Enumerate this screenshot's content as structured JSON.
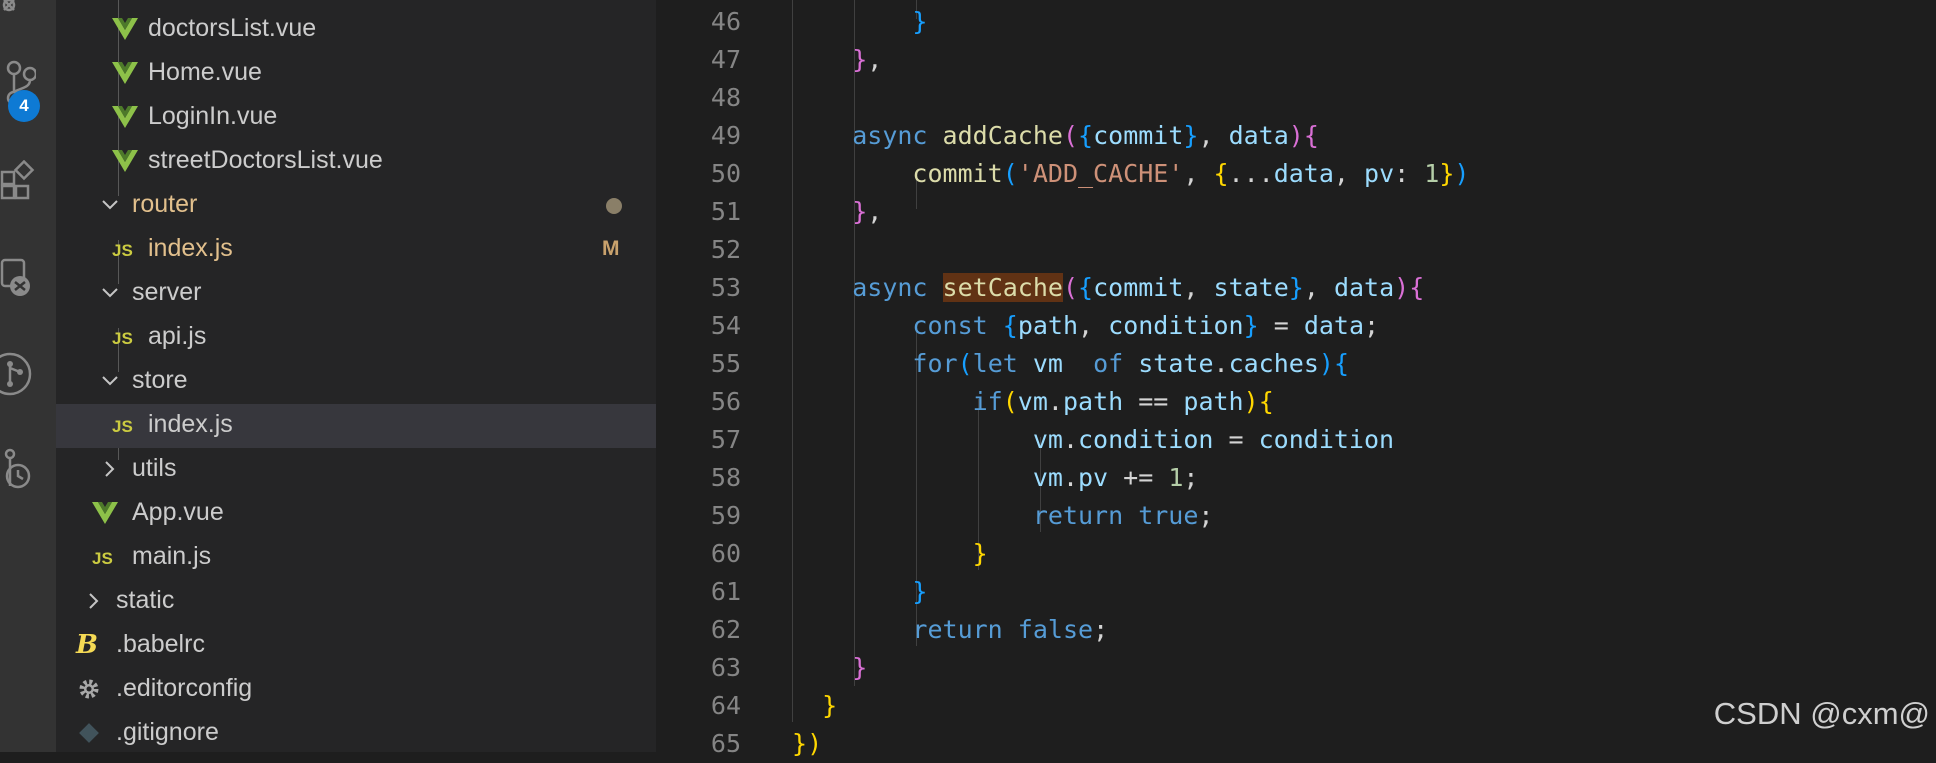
{
  "activity_bar": {
    "scm_badge": "4"
  },
  "explorer": {
    "items": [
      {
        "label": "doctorsList.vue",
        "icon": "vue-icon",
        "indent": 2
      },
      {
        "label": "Home.vue",
        "icon": "vue-icon",
        "indent": 2
      },
      {
        "label": "LoginIn.vue",
        "icon": "vue-icon",
        "indent": 2
      },
      {
        "label": "streetDoctorsList.vue",
        "icon": "vue-icon",
        "indent": 2
      },
      {
        "label": "router",
        "icon": "chevron-down-icon",
        "indent": 1,
        "modified": true,
        "status": "dot"
      },
      {
        "label": "index.js",
        "icon": "js-icon",
        "indent": 2,
        "modified": true,
        "status": "M"
      },
      {
        "label": "server",
        "icon": "chevron-down-icon",
        "indent": 1
      },
      {
        "label": "api.js",
        "icon": "js-icon",
        "indent": 2
      },
      {
        "label": "store",
        "icon": "chevron-down-icon",
        "indent": 1
      },
      {
        "label": "index.js",
        "icon": "js-icon",
        "indent": 2,
        "selected": true
      },
      {
        "label": "utils",
        "icon": "chevron-right-icon",
        "indent": 1
      },
      {
        "label": "App.vue",
        "icon": "vue-icon",
        "indent": 1
      },
      {
        "label": "main.js",
        "icon": "js-icon",
        "indent": 1
      },
      {
        "label": "static",
        "icon": "chevron-right-icon",
        "indent": 0
      },
      {
        "label": ".babelrc",
        "icon": "babel-icon",
        "indent": 0
      },
      {
        "label": ".editorconfig",
        "icon": "gear-icon",
        "indent": 0
      },
      {
        "label": ".gitignore",
        "icon": "git-icon",
        "indent": 0
      }
    ]
  },
  "editor": {
    "lines": [
      {
        "n": "46",
        "text": "        }"
      },
      {
        "n": "47",
        "text": "    },"
      },
      {
        "n": "48",
        "text": ""
      },
      {
        "n": "49",
        "text": "    async addCache({commit}, data){"
      },
      {
        "n": "50",
        "text": "        commit('ADD_CACHE', {...data, pv: 1})"
      },
      {
        "n": "51",
        "text": "    },"
      },
      {
        "n": "52",
        "text": ""
      },
      {
        "n": "53",
        "text": "    async setCache({commit, state}, data){"
      },
      {
        "n": "54",
        "text": "        const {path, condition} = data;"
      },
      {
        "n": "55",
        "text": "        for(let vm  of state.caches){"
      },
      {
        "n": "56",
        "text": "            if(vm.path == path){"
      },
      {
        "n": "57",
        "text": "                vm.condition = condition"
      },
      {
        "n": "58",
        "text": "                vm.pv += 1;"
      },
      {
        "n": "59",
        "text": "                return true;"
      },
      {
        "n": "60",
        "text": "            }"
      },
      {
        "n": "61",
        "text": "        }"
      },
      {
        "n": "62",
        "text": "        return false;"
      },
      {
        "n": "63",
        "text": "    }"
      },
      {
        "n": "64",
        "text": "  }"
      },
      {
        "n": "65",
        "text": "})"
      }
    ]
  },
  "colors": {
    "keyword": "#569cd6",
    "function": "#dcdcaa",
    "variable": "#9cdcfe",
    "string": "#ce9178",
    "number": "#b5cea8",
    "bracket1": "#ffd700",
    "bracket2": "#da70d6",
    "bracket3": "#179fff"
  },
  "watermark": "CSDN @cxm@"
}
